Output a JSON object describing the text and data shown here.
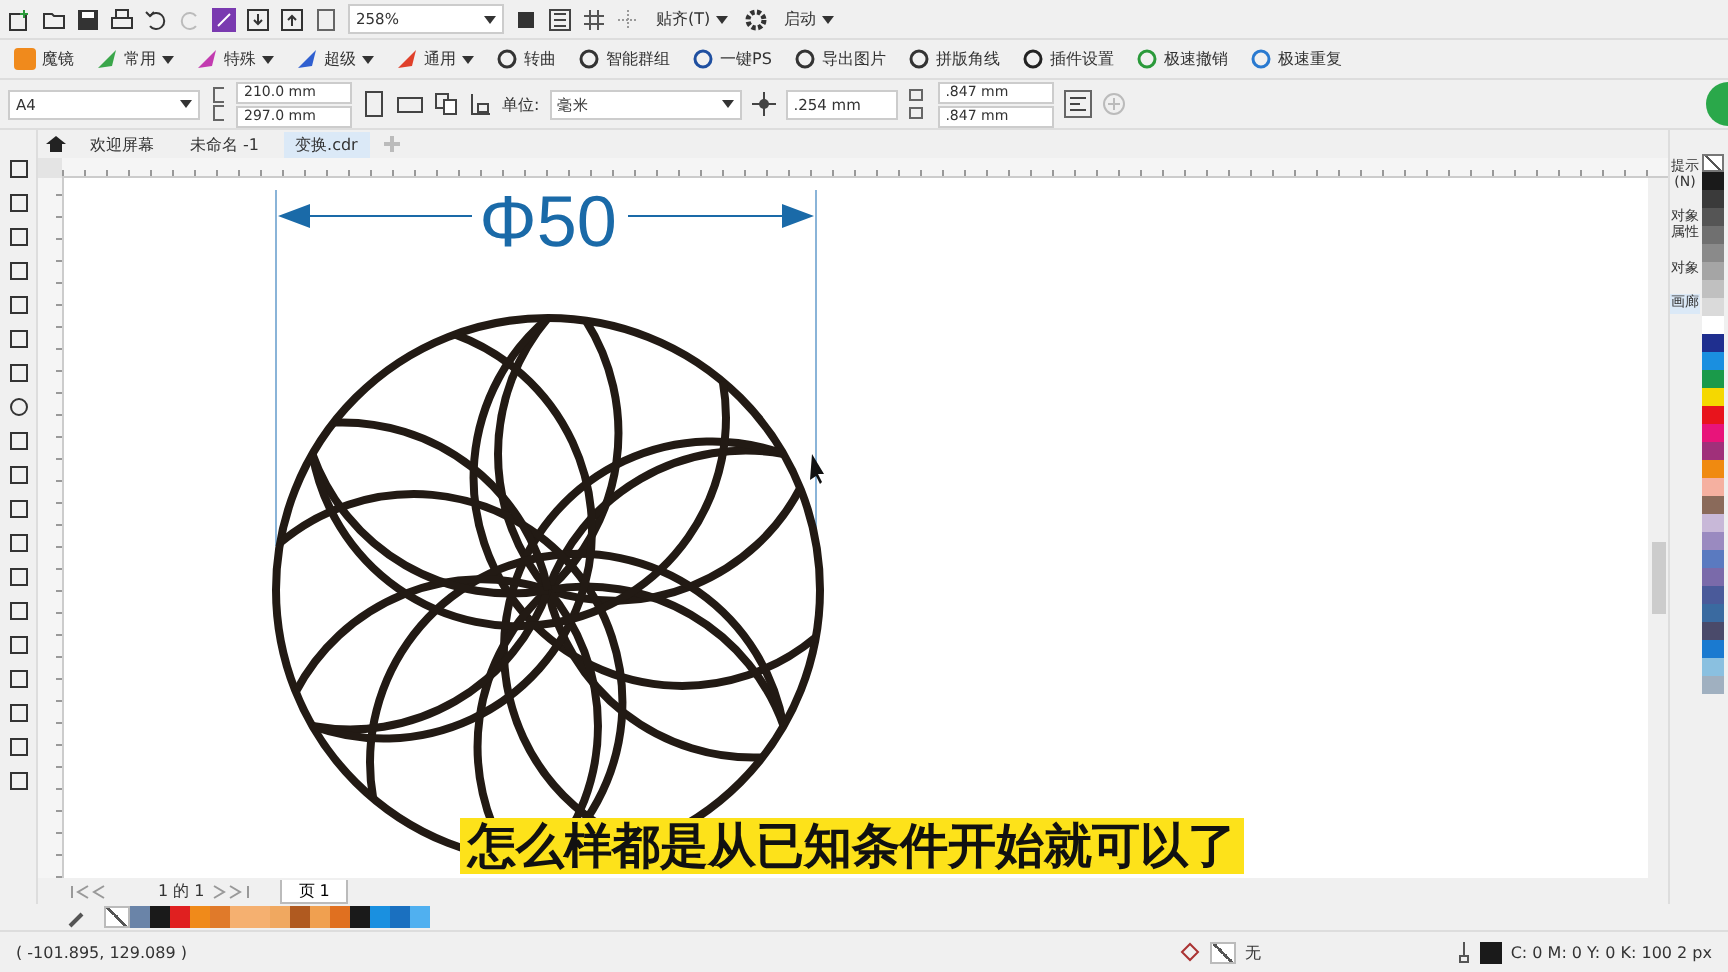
{
  "toolbar": {
    "zoom": "258%",
    "snap": "贴齐(T)",
    "launch": "启动"
  },
  "plugin_bar": [
    {
      "label": "魔镜",
      "kind": "logo",
      "color": "#f08a1c"
    },
    {
      "label": "常用",
      "kind": "menu",
      "color": "#3aa64a"
    },
    {
      "label": "特殊",
      "kind": "menu",
      "color": "#c23bb0"
    },
    {
      "label": "超级",
      "kind": "menu",
      "color": "#2f5fd0"
    },
    {
      "label": "通用",
      "kind": "menu",
      "color": "#e0402a"
    },
    {
      "label": "转曲",
      "kind": "action",
      "color": "#333333"
    },
    {
      "label": "智能群组",
      "kind": "action",
      "color": "#333333"
    },
    {
      "label": "一键PS",
      "kind": "action",
      "color": "#1f4fa0"
    },
    {
      "label": "导出图片",
      "kind": "action",
      "color": "#333333"
    },
    {
      "label": "拼版角线",
      "kind": "action",
      "color": "#333333"
    },
    {
      "label": "插件设置",
      "kind": "action",
      "color": "#222222"
    },
    {
      "label": "极速撤销",
      "kind": "action",
      "color": "#2a9a3a"
    },
    {
      "label": "极速重复",
      "kind": "action",
      "color": "#2a7ad0"
    }
  ],
  "property_bar": {
    "page_size": "A4",
    "width": "210.0 mm",
    "height": "297.0 mm",
    "unit_label": "单位:",
    "unit": "毫米",
    "nudge": ".254 mm",
    "dup_x": ".847 mm",
    "dup_y": ".847 mm"
  },
  "tabs": [
    {
      "label": "欢迎屏幕",
      "selected": false
    },
    {
      "label": "未命名 -1",
      "selected": false
    },
    {
      "label": "变换.cdr",
      "selected": true
    }
  ],
  "dimension": {
    "label": "Φ50"
  },
  "subtitle": "怎么样都是从已知条件开始就可以了",
  "dockers": [
    {
      "label": "提示(N)",
      "selected": false
    },
    {
      "label": "对象属性",
      "selected": false
    },
    {
      "label": "对象",
      "selected": false
    },
    {
      "label": "画廊",
      "selected": true
    }
  ],
  "page_nav": {
    "counter": "1 的 1",
    "page_tab": "页 1"
  },
  "palette_right": [
    {
      "color": "#1a1a1a"
    },
    {
      "color": "#3a3a3a"
    },
    {
      "color": "#555555"
    },
    {
      "color": "#707070"
    },
    {
      "color": "#8a8a8a"
    },
    {
      "color": "#a5a5a5"
    },
    {
      "color": "#c0c0c0"
    },
    {
      "color": "#dadada"
    },
    {
      "color": "#ffffff"
    },
    {
      "color": "#1f2f8f"
    },
    {
      "color": "#1a8fe0"
    },
    {
      "color": "#1a9a4a"
    },
    {
      "color": "#f5d800"
    },
    {
      "color": "#e8141c"
    },
    {
      "color": "#e8147a"
    },
    {
      "color": "#a0307a"
    },
    {
      "color": "#f08a10"
    },
    {
      "color": "#f5b0a0"
    },
    {
      "color": "#8a6a5a"
    },
    {
      "color": "#c8b8d8"
    },
    {
      "color": "#9a8ac0"
    },
    {
      "color": "#5a7ac0"
    },
    {
      "color": "#7a6aaa"
    },
    {
      "color": "#4a5a9a"
    },
    {
      "color": "#3a6aa0"
    },
    {
      "color": "#4a4a6a"
    },
    {
      "color": "#1a7ad0"
    },
    {
      "color": "#8ac0e0"
    },
    {
      "color": "#a0b0c0"
    }
  ],
  "palette_bottom": [
    {
      "color": "#6a84a8"
    },
    {
      "color": "#1a1a1a"
    },
    {
      "color": "#e02020"
    },
    {
      "color": "#f08a1a"
    },
    {
      "color": "#e07a2a"
    },
    {
      "color": "#f5b070"
    },
    {
      "color": "#f5b070"
    },
    {
      "color": "#f0a860"
    },
    {
      "color": "#b05a20"
    },
    {
      "color": "#f0a050"
    },
    {
      "color": "#e07020"
    },
    {
      "color": "#1a1a1a"
    },
    {
      "color": "#1a90e0"
    },
    {
      "color": "#1a70c0"
    },
    {
      "color": "#50b0f0"
    }
  ],
  "status": {
    "coords": "( -101.895, 129.089 )",
    "fill": "无",
    "outline": "C: 0 M: 0 Y: 0 K: 100  2 px"
  }
}
